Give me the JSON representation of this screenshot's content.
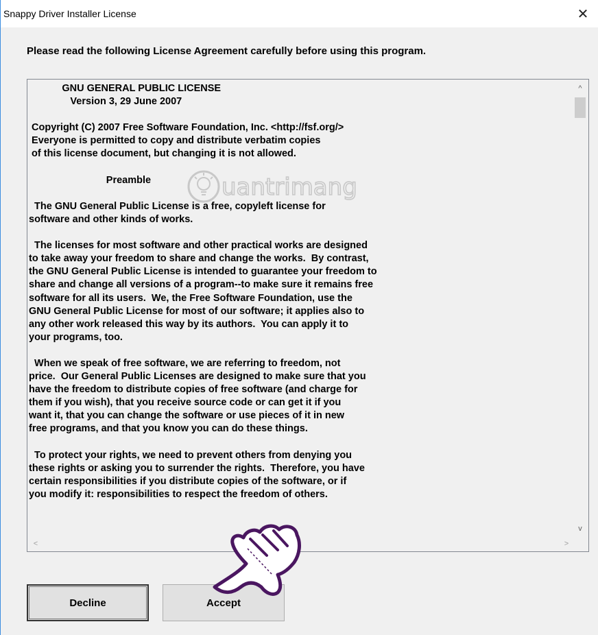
{
  "window": {
    "title": "Snappy Driver Installer License",
    "close_glyph": "✕"
  },
  "intro": "Please read the following License Agreement carefully before using this program.",
  "license_text": "            GNU GENERAL PUBLIC LICENSE\n               Version 3, 29 June 2007\n\n Copyright (C) 2007 Free Software Foundation, Inc. <http://fsf.org/>\n Everyone is permitted to copy and distribute verbatim copies\n of this license document, but changing it is not allowed.\n\n                            Preamble\n\n  The GNU General Public License is a free, copyleft license for\nsoftware and other kinds of works.\n\n  The licenses for most software and other practical works are designed\nto take away your freedom to share and change the works.  By contrast,\nthe GNU General Public License is intended to guarantee your freedom to\nshare and change all versions of a program--to make sure it remains free\nsoftware for all its users.  We, the Free Software Foundation, use the\nGNU General Public License for most of our software; it applies also to\nany other work released this way by its authors.  You can apply it to\nyour programs, too.\n\n  When we speak of free software, we are referring to freedom, not\nprice.  Our General Public Licenses are designed to make sure that you\nhave the freedom to distribute copies of free software (and charge for\nthem if you wish), that you receive source code or can get it if you\nwant it, that you can change the software or use pieces of it in new\nfree programs, and that you know you can do these things.\n\n  To protect your rights, we need to prevent others from denying you\nthese rights or asking you to surrender the rights.  Therefore, you have\ncertain responsibilities if you distribute copies of the software, or if\nyou modify it: responsibilities to respect the freedom of others.",
  "scrollbars": {
    "up_glyph": "^",
    "down_glyph": "v",
    "left_glyph": "<",
    "right_glyph": ">"
  },
  "buttons": {
    "decline": "Decline",
    "accept": "Accept"
  },
  "watermark": {
    "text": "uantrimang",
    "icon": "bulb-icon"
  },
  "colors": {
    "window_bg": "#f0f0f0",
    "button_bg": "#e1e1e1",
    "watermark": "#c8c8c8"
  }
}
